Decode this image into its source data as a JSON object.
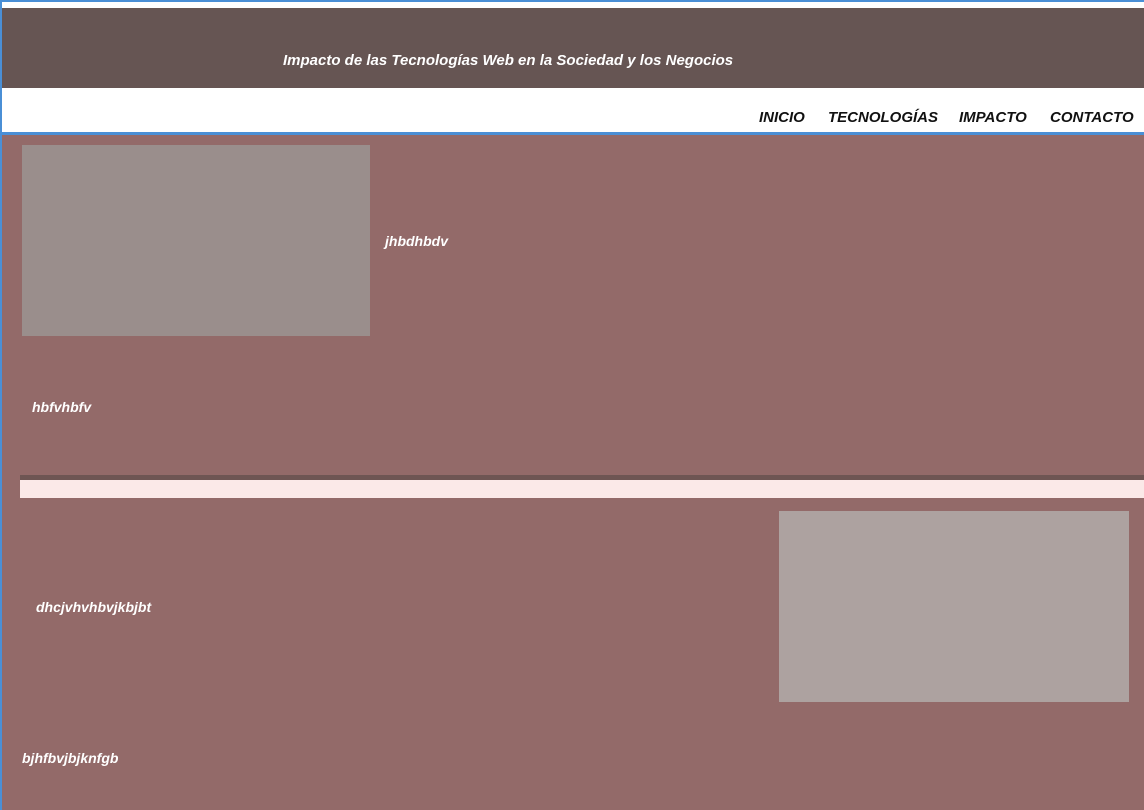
{
  "header": {
    "title": "Impacto de las Tecnologías Web en  la Sociedad y los Negocios"
  },
  "nav": {
    "items": [
      "INICIO",
      "TECNOLOGÍAS",
      "IMPACTO",
      "CONTACTO"
    ]
  },
  "sections": [
    {
      "caption": "jhbdhbdv",
      "text": "hbfvhbfv"
    },
    {
      "caption": "dhcjvhvhbvjkbjbt",
      "text": "bjhfbvjbjknfgb"
    }
  ],
  "colors": {
    "header_bg": "#665553",
    "main_bg": "#936a69",
    "accent_border": "#4a8fd6",
    "divider_light": "#fbe9e8"
  }
}
